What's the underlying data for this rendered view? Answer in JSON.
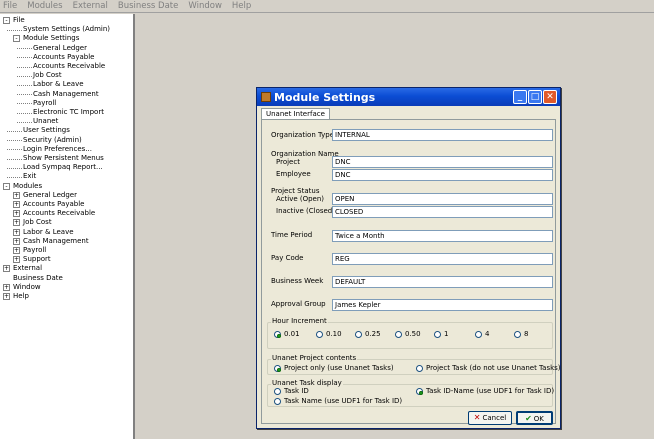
{
  "menubar": [
    "File",
    "Modules",
    "External",
    "Business Date",
    "Window",
    "Help"
  ],
  "tree": [
    {
      "label": "File",
      "level": 0,
      "expander": "-"
    },
    {
      "label": "System Settings (Admin)",
      "level": 1,
      "expander": ""
    },
    {
      "label": "Module Settings",
      "level": 1,
      "expander": "-"
    },
    {
      "label": "General Ledger",
      "level": 2,
      "expander": ""
    },
    {
      "label": "Accounts Payable",
      "level": 2,
      "expander": ""
    },
    {
      "label": "Accounts Receivable",
      "level": 2,
      "expander": ""
    },
    {
      "label": "Job Cost",
      "level": 2,
      "expander": ""
    },
    {
      "label": "Labor & Leave",
      "level": 2,
      "expander": ""
    },
    {
      "label": "Cash Management",
      "level": 2,
      "expander": ""
    },
    {
      "label": "Payroll",
      "level": 2,
      "expander": ""
    },
    {
      "label": "Electronic TC Import",
      "level": 2,
      "expander": ""
    },
    {
      "label": "Unanet",
      "level": 2,
      "expander": ""
    },
    {
      "label": "User Settings",
      "level": 1,
      "expander": ""
    },
    {
      "label": "Security  (Admin)",
      "level": 1,
      "expander": ""
    },
    {
      "label": "Login Preferences...",
      "level": 1,
      "expander": ""
    },
    {
      "label": "Show Persistent Menus",
      "level": 1,
      "expander": ""
    },
    {
      "label": "Load Sympaq Report...",
      "level": 1,
      "expander": ""
    },
    {
      "label": "Exit",
      "level": 1,
      "expander": ""
    },
    {
      "label": "Modules",
      "level": 0,
      "expander": "-"
    },
    {
      "label": "General Ledger",
      "level": 1,
      "expander": "+"
    },
    {
      "label": "Accounts Payable",
      "level": 1,
      "expander": "+"
    },
    {
      "label": "Accounts Receivable",
      "level": 1,
      "expander": "+"
    },
    {
      "label": "Job Cost",
      "level": 1,
      "expander": "+"
    },
    {
      "label": "Labor & Leave",
      "level": 1,
      "expander": "+"
    },
    {
      "label": "Cash Management",
      "level": 1,
      "expander": "+"
    },
    {
      "label": "Payroll",
      "level": 1,
      "expander": "+"
    },
    {
      "label": "Support",
      "level": 1,
      "expander": "+"
    },
    {
      "label": "External",
      "level": 0,
      "expander": "+"
    },
    {
      "label": "Business Date",
      "level": 0,
      "expander": ""
    },
    {
      "label": "Window",
      "level": 0,
      "expander": "+"
    },
    {
      "label": "Help",
      "level": 0,
      "expander": "+"
    }
  ],
  "dialog": {
    "title": "Module Settings",
    "tab": "Unanet Interface",
    "org_type_label": "Organization Type",
    "org_type_value": "INTERNAL",
    "org_name_label": "Organization Name",
    "project_label": "Project",
    "project_value": "DNC",
    "employee_label": "Employee",
    "employee_value": "DNC",
    "project_status_label": "Project Status",
    "active_label": "Active (Open)",
    "active_value": "OPEN",
    "inactive_label": "Inactive (Closed)",
    "inactive_value": "CLOSED",
    "time_period_label": "Time Period",
    "time_period_value": "Twice a Month",
    "pay_code_label": "Pay Code",
    "pay_code_value": "REG",
    "business_week_label": "Business Week",
    "business_week_value": "DEFAULT",
    "approval_group_label": "Approval Group",
    "approval_group_value": "James Kepler",
    "hour_increment": {
      "title": "Hour Increment",
      "options": [
        "0.01",
        "0.10",
        "0.25",
        "0.50",
        "1",
        "4",
        "8"
      ],
      "selected": 0
    },
    "project_contents": {
      "title": "Unanet Project contents",
      "options": [
        "Project only (use Unanet Tasks)",
        "Project Task (do not use Unanet Tasks)"
      ],
      "selected": 0
    },
    "task_display": {
      "title": "Unanet Task display",
      "options": [
        "Task ID",
        "Task ID-Name (use UDF1 for Task ID)",
        "Task Name (use UDF1 for Task ID)"
      ],
      "selected": 1
    },
    "cancel_label": "Cancel",
    "ok_label": "OK"
  },
  "colors": {
    "titlebar": "#0b4dd4",
    "dialog_bg": "#ece9d8",
    "desktop_bg": "#d4d0c8"
  }
}
